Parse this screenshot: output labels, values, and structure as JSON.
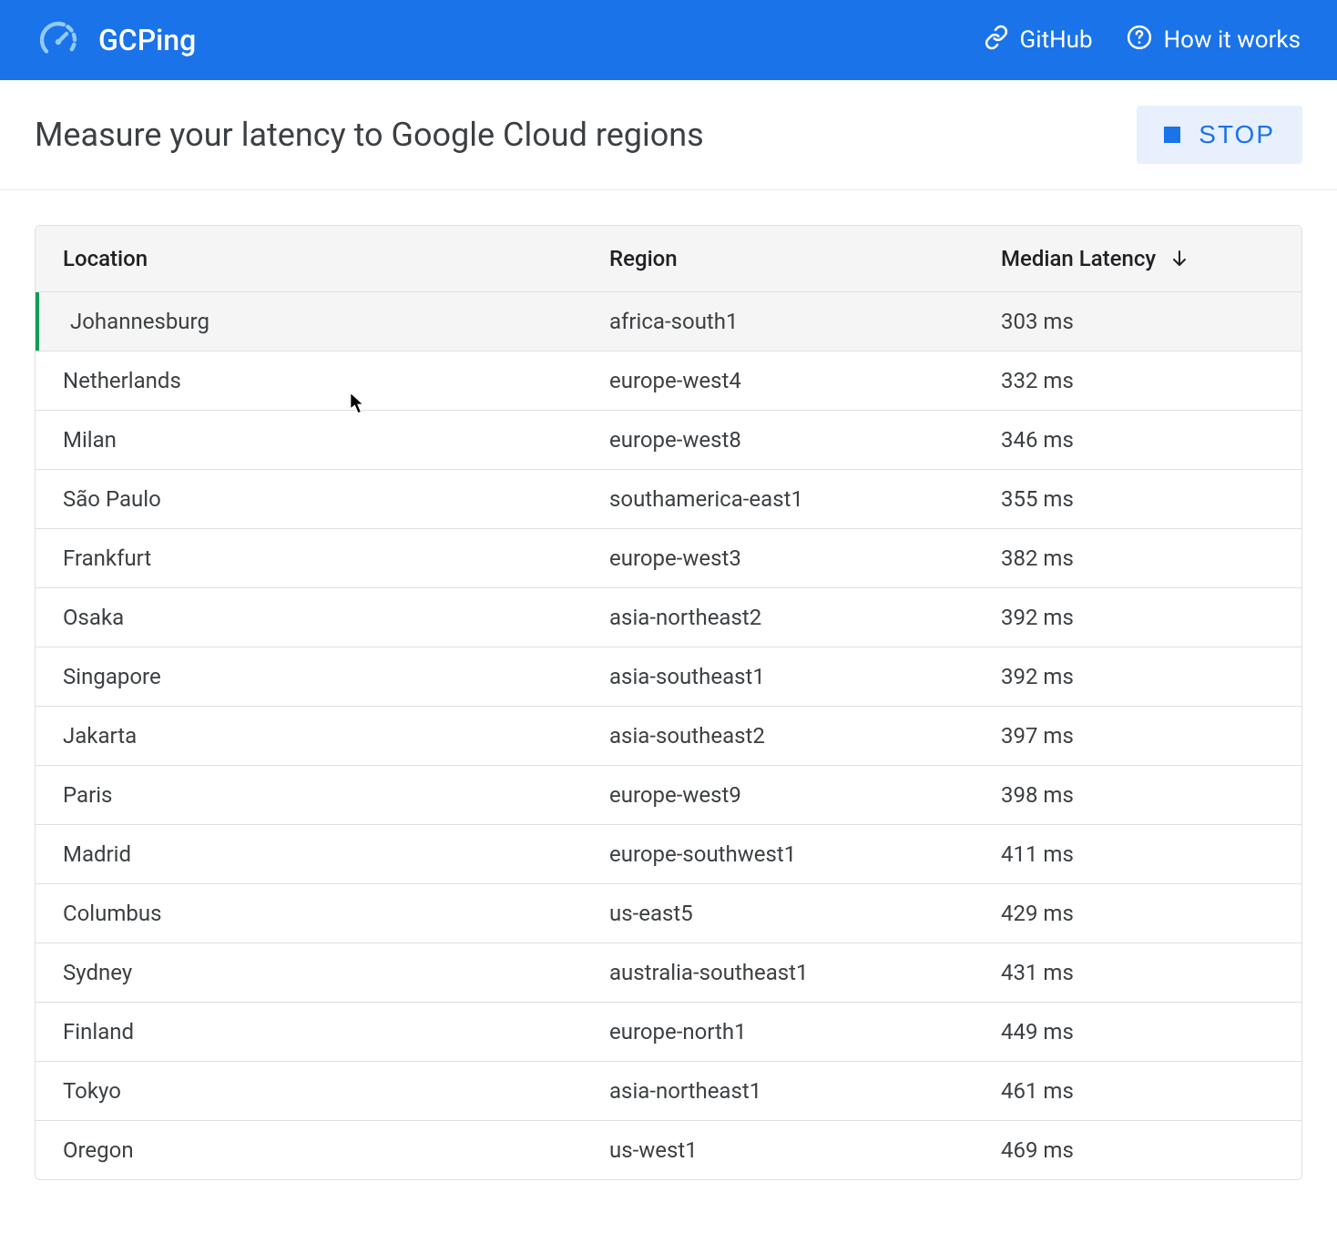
{
  "header": {
    "title": "GCPing",
    "links": {
      "github": "GitHub",
      "how_it_works": "How it works"
    }
  },
  "topbar": {
    "title": "Measure your latency to Google Cloud regions",
    "stop_label": "STOP"
  },
  "table": {
    "headers": {
      "location": "Location",
      "region": "Region",
      "latency": "Median Latency"
    },
    "rows": [
      {
        "location": "Johannesburg",
        "region": "africa-south1",
        "latency": "303 ms",
        "highlighted": true
      },
      {
        "location": "Netherlands",
        "region": "europe-west4",
        "latency": "332 ms",
        "highlighted": false
      },
      {
        "location": "Milan",
        "region": "europe-west8",
        "latency": "346 ms",
        "highlighted": false
      },
      {
        "location": "São Paulo",
        "region": "southamerica-east1",
        "latency": "355 ms",
        "highlighted": false
      },
      {
        "location": "Frankfurt",
        "region": "europe-west3",
        "latency": "382 ms",
        "highlighted": false
      },
      {
        "location": "Osaka",
        "region": "asia-northeast2",
        "latency": "392 ms",
        "highlighted": false
      },
      {
        "location": "Singapore",
        "region": "asia-southeast1",
        "latency": "392 ms",
        "highlighted": false
      },
      {
        "location": "Jakarta",
        "region": "asia-southeast2",
        "latency": "397 ms",
        "highlighted": false
      },
      {
        "location": "Paris",
        "region": "europe-west9",
        "latency": "398 ms",
        "highlighted": false
      },
      {
        "location": "Madrid",
        "region": "europe-southwest1",
        "latency": "411 ms",
        "highlighted": false
      },
      {
        "location": "Columbus",
        "region": "us-east5",
        "latency": "429 ms",
        "highlighted": false
      },
      {
        "location": "Sydney",
        "region": "australia-southeast1",
        "latency": "431 ms",
        "highlighted": false
      },
      {
        "location": "Finland",
        "region": "europe-north1",
        "latency": "449 ms",
        "highlighted": false
      },
      {
        "location": "Tokyo",
        "region": "asia-northeast1",
        "latency": "461 ms",
        "highlighted": false
      },
      {
        "location": "Oregon",
        "region": "us-west1",
        "latency": "469 ms",
        "highlighted": false
      }
    ]
  }
}
